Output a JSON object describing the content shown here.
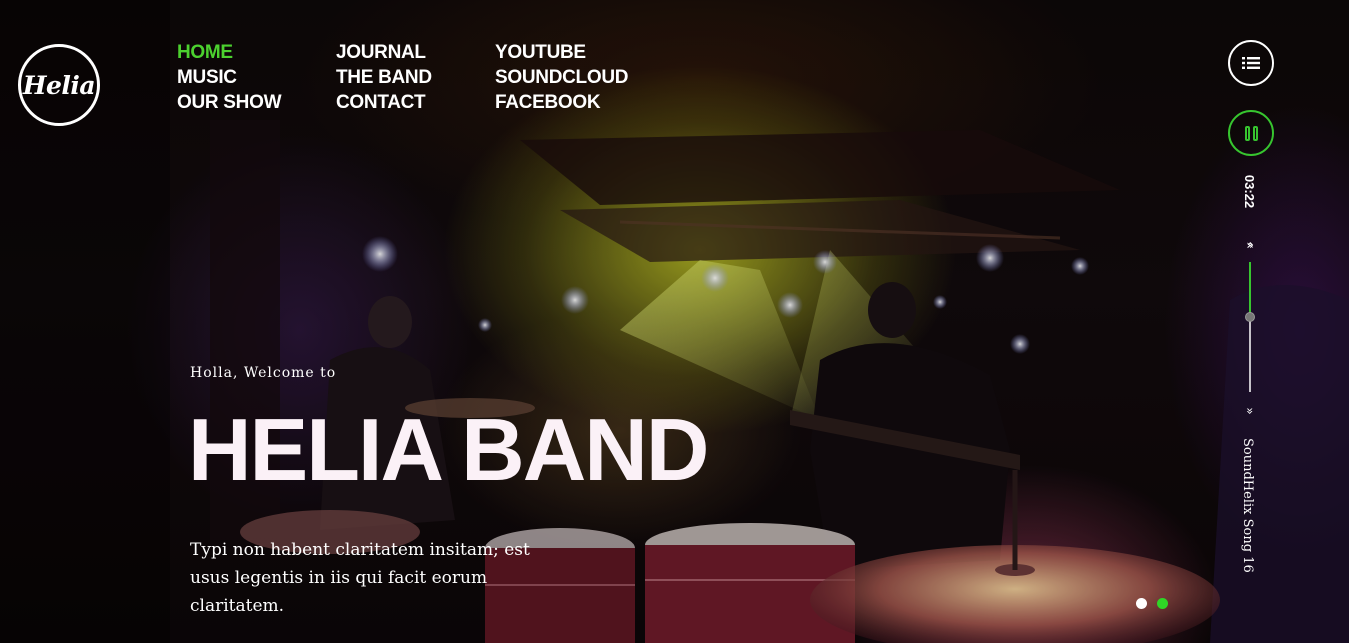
{
  "brand": {
    "logo_text": "Helia"
  },
  "nav": {
    "columns": [
      [
        "HOME",
        "MUSIC",
        "OUR SHOW"
      ],
      [
        "JOURNAL",
        "THE BAND",
        "CONTACT"
      ],
      [
        "YOUTUBE",
        "SOUNDCLOUD",
        "FACEBOOK"
      ]
    ],
    "active": "HOME"
  },
  "player": {
    "menu_icon": "list-icon",
    "pause_icon": "pause-icon",
    "time": "03:22",
    "volume": 0.42,
    "track_name": "SoundHelix Song 16"
  },
  "hero": {
    "welcome": "Holla, Welcome to",
    "title": "HELIA BAND",
    "description": "Typi non habent claritatem insitam; est usus legentis in iis qui facit eorum claritatem."
  },
  "slider": {
    "count": 2,
    "active_index": 1
  },
  "colors": {
    "accent": "#37c52f",
    "active_link": "#4cd12f",
    "title_text": "#fbf1f7"
  }
}
